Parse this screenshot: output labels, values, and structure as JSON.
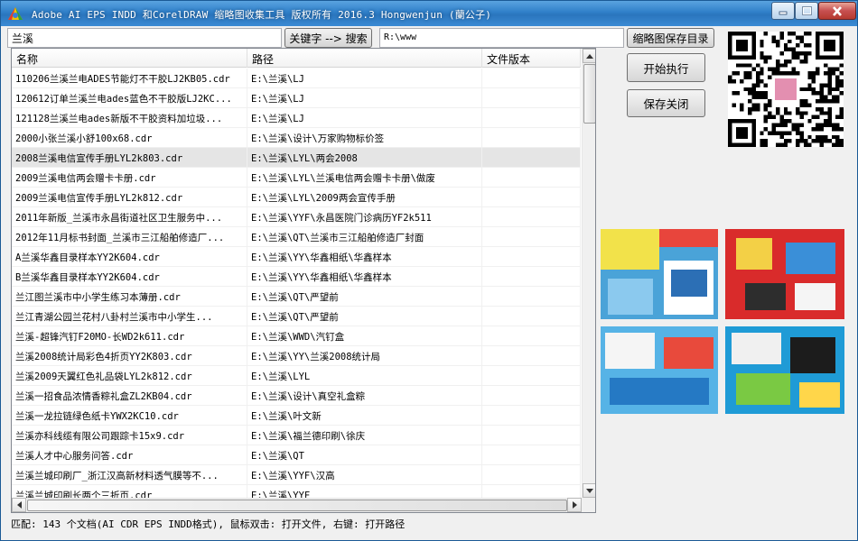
{
  "window": {
    "title": "Adobe AI EPS INDD 和CorelDRAW 缩略图收集工具  版权所有 2016.3 Hongwenjun (蘭公子)"
  },
  "toolbar": {
    "keyword_value": "兰溪",
    "keyword_search_button": "关键字 --> 搜索",
    "path_value": "R:\\www",
    "save_dir_button": "缩略图保存目录"
  },
  "table": {
    "columns": [
      "名称",
      "路径",
      "文件版本"
    ],
    "rows": [
      {
        "name": "110206兰溪兰电ADES节能灯不干胶LJ2KB05.cdr",
        "path": "E:\\兰溪\\LJ",
        "version": ""
      },
      {
        "name": "120612订单兰溪兰电ades蓝色不干胶版LJ2KC...",
        "path": "E:\\兰溪\\LJ",
        "version": ""
      },
      {
        "name": "121128兰溪兰电ades新版不干胶资料加垃圾...",
        "path": "E:\\兰溪\\LJ",
        "version": ""
      },
      {
        "name": "2000小张兰溪小舒100x68.cdr",
        "path": "E:\\兰溪\\设计\\万家购物标价签",
        "version": ""
      },
      {
        "name": "2008兰溪电信宣传手册LYL2k803.cdr",
        "path": "E:\\兰溪\\LYL\\两会2008",
        "version": "",
        "selected": true
      },
      {
        "name": "2009兰溪电信两会赠卡卡册.cdr",
        "path": "E:\\兰溪\\LYL\\兰溪电信两会赠卡卡册\\做废",
        "version": ""
      },
      {
        "name": "2009兰溪电信宣传手册LYL2k812.cdr",
        "path": "E:\\兰溪\\LYL\\2009两会宣传手册",
        "version": ""
      },
      {
        "name": "2011年新版_兰溪市永昌街道社区卫生服务中...",
        "path": "E:\\兰溪\\YYF\\永昌医院门诊病历YF2k511",
        "version": ""
      },
      {
        "name": "2012年11月标书封面_兰溪市三江船舶修造厂...",
        "path": "E:\\兰溪\\QT\\兰溪市三江船舶修造厂封面",
        "version": ""
      },
      {
        "name": "A兰溪华鑫目录样本YY2K604.cdr",
        "path": "E:\\兰溪\\YY\\华鑫相纸\\华鑫样本",
        "version": ""
      },
      {
        "name": "B兰溪华鑫目录样本YY2K604.cdr",
        "path": "E:\\兰溪\\YY\\华鑫相纸\\华鑫样本",
        "version": ""
      },
      {
        "name": "兰江图兰溪市中小学生练习本薄册.cdr",
        "path": "E:\\兰溪\\QT\\严望前",
        "version": ""
      },
      {
        "name": "兰江青湖公园兰花村八卦村兰溪市中小学生...",
        "path": "E:\\兰溪\\QT\\严望前",
        "version": ""
      },
      {
        "name": "兰溪-超锋汽钉F20MO-长WD2k611.cdr",
        "path": "E:\\兰溪\\WWD\\汽钉盒",
        "version": ""
      },
      {
        "name": "兰溪2008统计局彩色4折页YY2K803.cdr",
        "path": "E:\\兰溪\\YY\\兰溪2008统计局",
        "version": ""
      },
      {
        "name": "兰溪2009天翼红色礼品袋LYL2k812.cdr",
        "path": "E:\\兰溪\\LYL",
        "version": ""
      },
      {
        "name": "兰溪一招食品浓情香粽礼盒ZL2KB04.cdr",
        "path": "E:\\兰溪\\设计\\真空礼盒粽",
        "version": ""
      },
      {
        "name": "兰溪一龙拉链绿色纸卡YWX2KC10.cdr",
        "path": "E:\\兰溪\\叶文新",
        "version": ""
      },
      {
        "name": "兰溪亦科线缆有限公司跟踪卡15x9.cdr",
        "path": "E:\\兰溪\\福兰德印刷\\徐庆",
        "version": ""
      },
      {
        "name": "兰溪人才中心服务问答.cdr",
        "path": "E:\\兰溪\\QT",
        "version": ""
      },
      {
        "name": "兰溪兰城印刷厂_浙江汉高新材料透气膜等不...",
        "path": "E:\\兰溪\\YYF\\汉高",
        "version": ""
      },
      {
        "name": "兰溪兰城印刷长两个三折页.cdr",
        "path": "E:\\兰溪\\YYF",
        "version": ""
      }
    ]
  },
  "actions": {
    "start_button": "开始执行",
    "save_close_button": "保存关闭"
  },
  "status": {
    "text": "匹配: 143 个文档(AI CDR EPS INDD格式), 鼠标双击: 打开文件, 右键: 打开路径"
  },
  "icons": {
    "app": "colorful-app-icon",
    "minimize": "minimize-icon",
    "maximize": "maximize-icon",
    "close": "close-icon"
  }
}
